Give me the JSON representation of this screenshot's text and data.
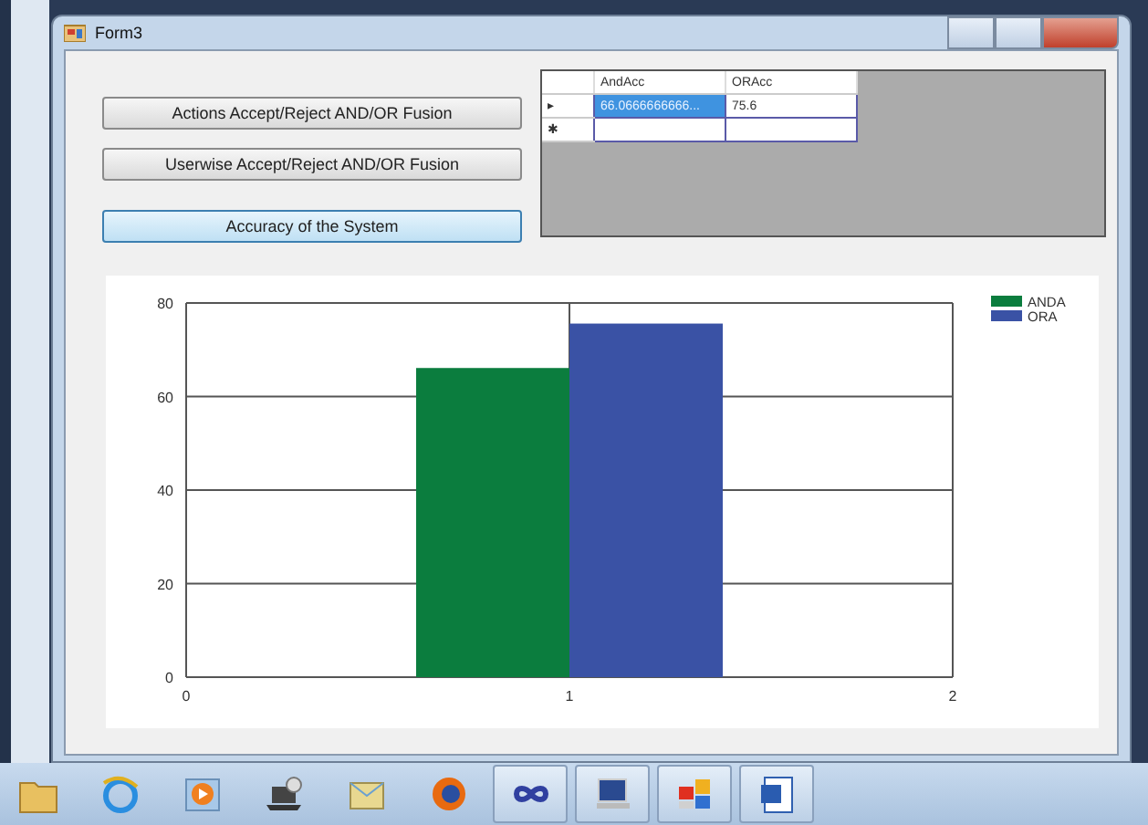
{
  "window": {
    "title": "Form3"
  },
  "buttons": [
    {
      "label": "Actions Accept/Reject  AND/OR Fusion",
      "focused": false
    },
    {
      "label": "Userwise Accept/Reject AND/OR Fusion",
      "focused": false
    },
    {
      "label": "Accuracy of the System",
      "focused": true
    }
  ],
  "grid": {
    "columns": [
      "AndAcc",
      "ORAcc"
    ],
    "rows": [
      {
        "marker": "▸",
        "cells": [
          {
            "text": "66.0666666666...",
            "selected": true
          },
          {
            "text": "75.6",
            "selected": false
          }
        ]
      },
      {
        "marker": "✱",
        "cells": [
          {
            "text": "",
            "selected": false
          },
          {
            "text": "",
            "selected": false
          }
        ]
      }
    ]
  },
  "chart": {
    "chart_data": {
      "type": "bar",
      "x": [
        0.8,
        1.2
      ],
      "grid": true,
      "legend": "right",
      "series": [
        {
          "name": "ANDA",
          "color": "#0b7d3e",
          "values": [
            66.1,
            null
          ]
        },
        {
          "name": "ORA",
          "color": "#3a52a5",
          "values": [
            null,
            75.6
          ]
        }
      ],
      "xlim": [
        0,
        2
      ],
      "ylim": [
        0,
        80
      ],
      "xticks": [
        0,
        1,
        2
      ],
      "yticks": [
        0,
        20,
        40,
        60,
        80
      ]
    }
  },
  "taskbar": [
    {
      "kind": "folder",
      "running": false
    },
    {
      "kind": "browser",
      "running": false
    },
    {
      "kind": "media",
      "running": false
    },
    {
      "kind": "laptop",
      "running": false
    },
    {
      "kind": "mail",
      "running": false
    },
    {
      "kind": "globe",
      "running": false
    },
    {
      "kind": "infinity",
      "running": true
    },
    {
      "kind": "monitor",
      "running": true
    },
    {
      "kind": "tiles",
      "running": true
    },
    {
      "kind": "document",
      "running": true
    }
  ]
}
